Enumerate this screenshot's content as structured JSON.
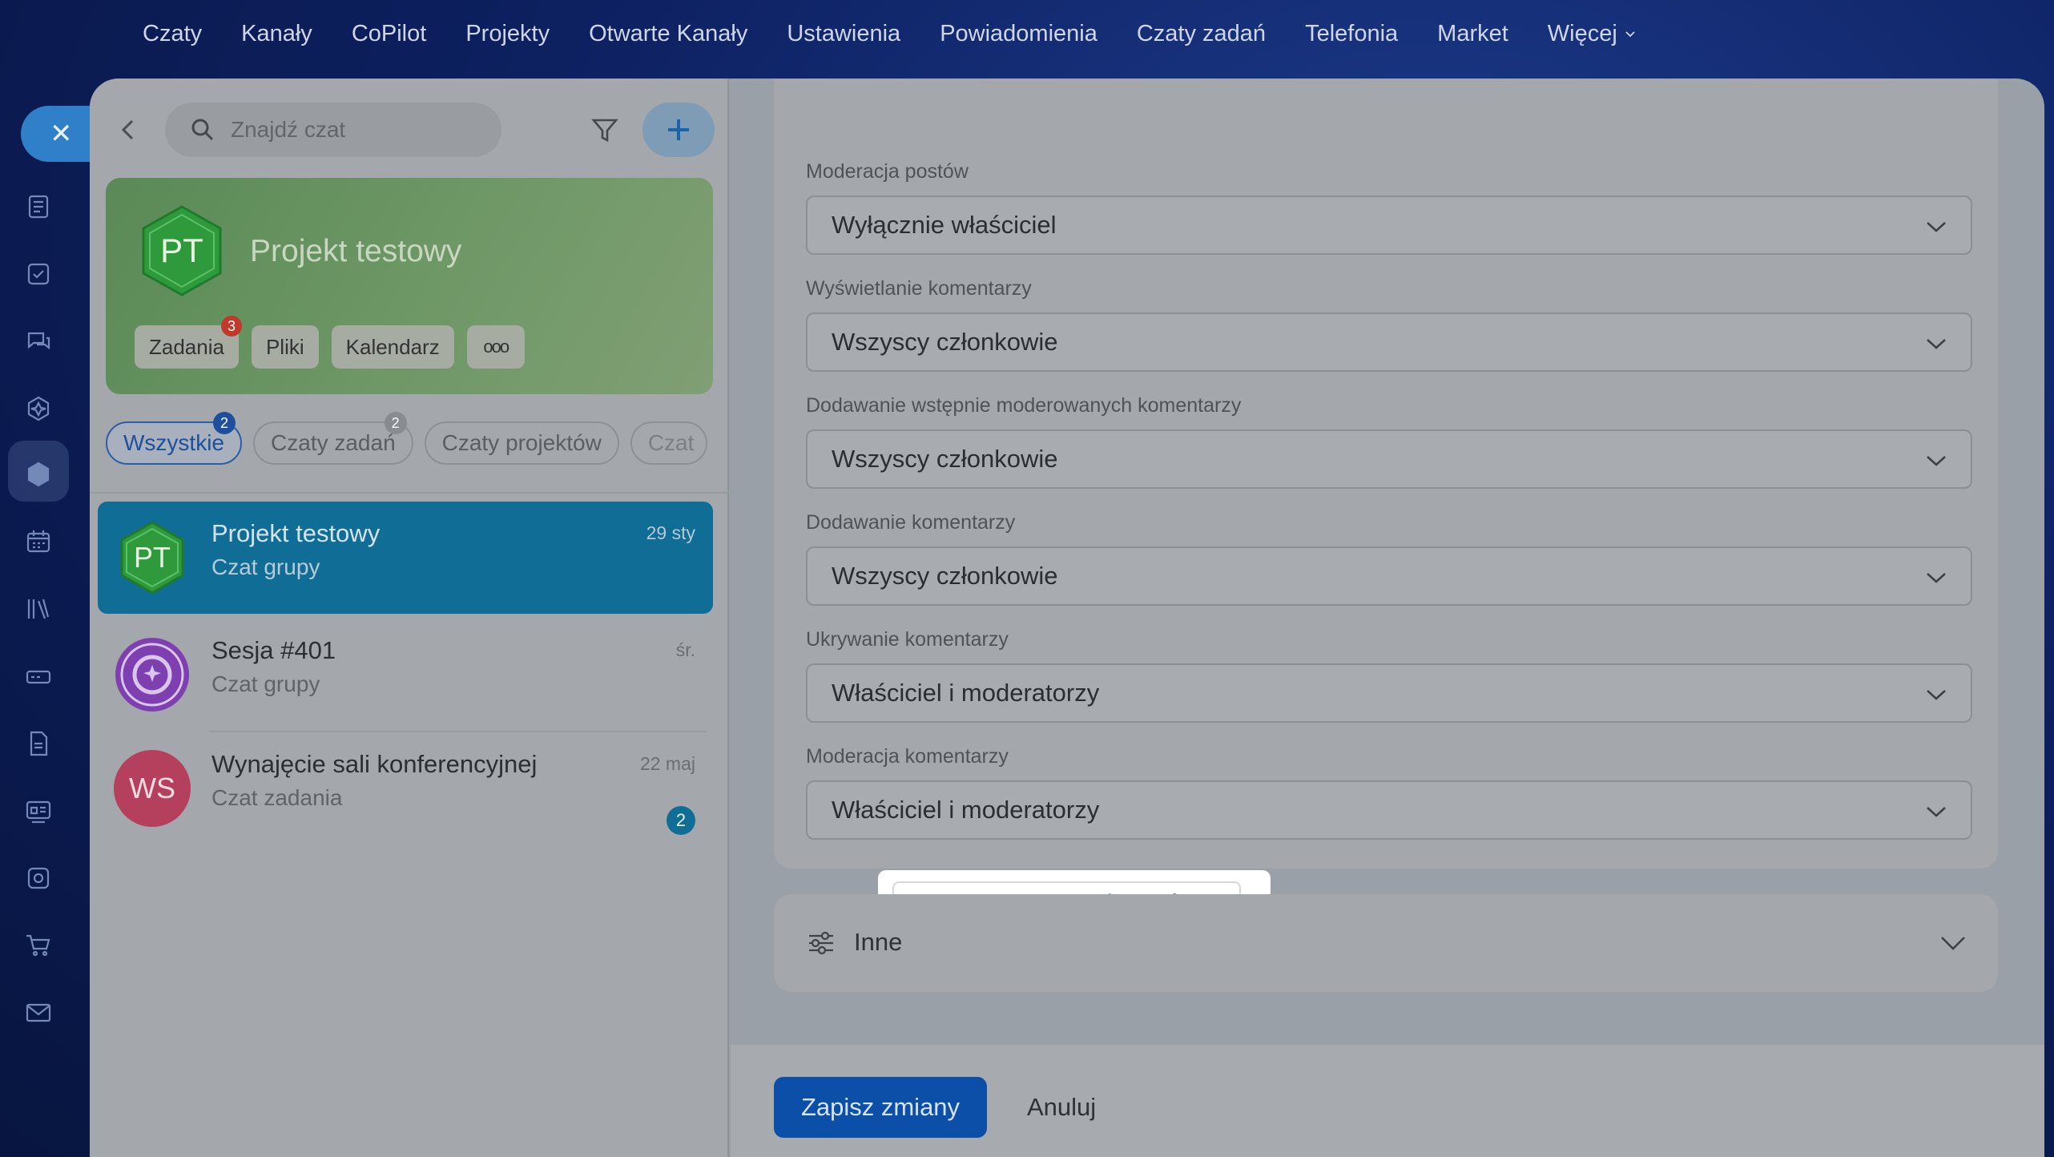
{
  "topnav": {
    "items": [
      "Czaty",
      "Kanały",
      "CoPilot",
      "Projekty",
      "Otwarte Kanały",
      "Ustawienia",
      "Powiadomienia",
      "Czaty zadań",
      "Telefonia",
      "Market"
    ],
    "more_label": "Więcej"
  },
  "rail": {
    "close_symbol": "✕",
    "icons": [
      "feed-icon",
      "tasks-icon",
      "chat-icon",
      "copilot-icon",
      "project-icon",
      "calendar-icon",
      "knowledge-icon",
      "drive-icon",
      "docs-icon",
      "crm-icon",
      "automation-icon",
      "shop-icon",
      "mail-icon"
    ]
  },
  "sidebar": {
    "search_placeholder": "Znajdź czat",
    "project": {
      "initials": "PT",
      "title": "Projekt testowy",
      "tabs": [
        {
          "label": "Zadania",
          "badge": "3"
        },
        {
          "label": "Pliki",
          "badge": ""
        },
        {
          "label": "Kalendarz",
          "badge": ""
        }
      ],
      "more_label": "ooo"
    },
    "filters": [
      {
        "label": "Wszystkie",
        "count": "2"
      },
      {
        "label": "Czaty zadań",
        "count": "2"
      },
      {
        "label": "Czaty projektów",
        "count": ""
      },
      {
        "label": "Czat",
        "count": ""
      }
    ],
    "chats": [
      {
        "initials": "PT",
        "title": "Projekt testowy",
        "subtitle": "Czat grupy",
        "date": "29 sty",
        "unread": ""
      },
      {
        "initials": "",
        "title": "Sesja #401",
        "subtitle": "Czat grupy",
        "date": "śr.",
        "unread": ""
      },
      {
        "initials": "WS",
        "title": "Wynajęcie sali konferencyjnej",
        "subtitle": "Czat zadania",
        "date": "22 maj",
        "unread": "2"
      }
    ]
  },
  "settings": {
    "fields": [
      {
        "label": "Moderacja postów",
        "value": "Wyłącznie właściciel"
      },
      {
        "label": "Wyświetlanie komentarzy",
        "value": "Wszyscy członkowie"
      },
      {
        "label": "Dodawanie wstępnie moderowanych komentarzy",
        "value": "Wszyscy członkowie"
      },
      {
        "label": "Dodawanie komentarzy",
        "value": "Wszyscy członkowie"
      },
      {
        "label": "Ukrywanie komentarzy",
        "value": "Właściciel i moderatorzy"
      },
      {
        "label": "Moderacja komentarzy",
        "value": "Właściciel i moderatorzy"
      }
    ],
    "reset_label": "Przywracanie ustawień domyślnych",
    "other_label": "Inne"
  },
  "footer": {
    "save_label": "Zapisz zmiany",
    "cancel_label": "Anuluj"
  },
  "colors": {
    "accent_blue": "#0b4fa8",
    "selected_chat": "#0f6d96",
    "project_green": "#2e9a3c",
    "badge_red": "#c0392b"
  }
}
